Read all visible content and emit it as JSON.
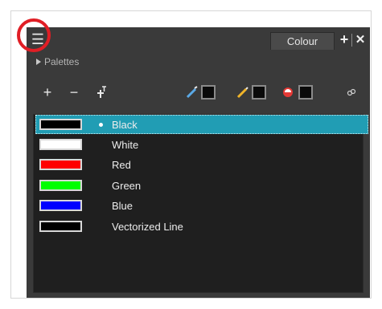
{
  "panel": {
    "tab_label": "Colour",
    "section_label": "Palettes"
  },
  "icons": {
    "menu": "hamburger-menu-icon",
    "add": "plus-icon",
    "remove": "minus-icon",
    "tint": "text-tint-icon",
    "line_picker": "pen-picker-icon",
    "pencil_picker": "pencil-picker-icon",
    "paint_picker": "paint-bucket-icon",
    "link": "link-icon",
    "tab_add": "plus-bold-icon",
    "tab_close": "close-icon"
  },
  "colors": {
    "panel_bg": "#3a3a3a",
    "list_bg": "#1f1f1f",
    "selection": "#219db4",
    "highlight_ring": "#e01e25"
  },
  "swatches": [
    {
      "name": "Black",
      "color": "#000000",
      "selected": true
    },
    {
      "name": "White",
      "color": "#ffffff",
      "selected": false
    },
    {
      "name": "Red",
      "color": "#ff0000",
      "selected": false
    },
    {
      "name": "Green",
      "color": "#00ff00",
      "selected": false
    },
    {
      "name": "Blue",
      "color": "#0000ff",
      "selected": false
    },
    {
      "name": "Vectorized Line",
      "color": "#000000",
      "selected": false
    }
  ]
}
